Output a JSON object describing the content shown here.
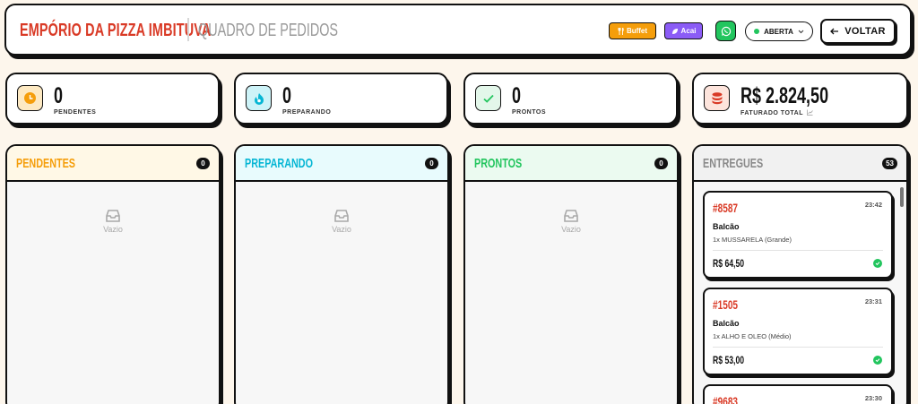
{
  "header": {
    "brand": "EMPÓRIO DA PIZZA IMBITUVA",
    "subtitle": "QUADRO DE PEDIDOS",
    "buffet_label": "Buffet",
    "acai_label": "Acai",
    "status_label": "ABERTA",
    "back_label": "VOLTAR"
  },
  "stats": [
    {
      "value": "0",
      "label": "PENDENTES",
      "color": "#f59e0b"
    },
    {
      "value": "0",
      "label": "PREPARANDO",
      "color": "#06b6d4"
    },
    {
      "value": "0",
      "label": "PRONTOS",
      "color": "#22c55e"
    },
    {
      "value": "R$ 2.824,50",
      "label": "FATURADO TOTAL",
      "color": "#d93a26"
    }
  ],
  "columns": [
    {
      "title": "PENDENTES",
      "count": "0",
      "empty_text": "Vazio",
      "color": "#f59e0b",
      "bg": "#fff8e6"
    },
    {
      "title": "PREPARANDO",
      "count": "0",
      "empty_text": "Vazio",
      "color": "#06b6d4",
      "bg": "#e8fbfd"
    },
    {
      "title": "PRONTOS",
      "count": "0",
      "empty_text": "Vazio",
      "color": "#22c55e",
      "bg": "#ebfaf0"
    },
    {
      "title": "ENTREGUES",
      "count": "53",
      "color": "#8a8a8a",
      "bg": "#f1f1f1"
    }
  ],
  "delivered_orders": [
    {
      "number": "#8587",
      "time": "23:42",
      "customer": "Balcão",
      "item": "1x MUSSARELA (Grande)",
      "total": "R$ 64,50"
    },
    {
      "number": "#1505",
      "time": "23:31",
      "customer": "Balcão",
      "item": "1x ALHO E OLEO (Médio)",
      "total": "R$ 53,00"
    },
    {
      "number": "#9683",
      "time": "23:30"
    }
  ]
}
